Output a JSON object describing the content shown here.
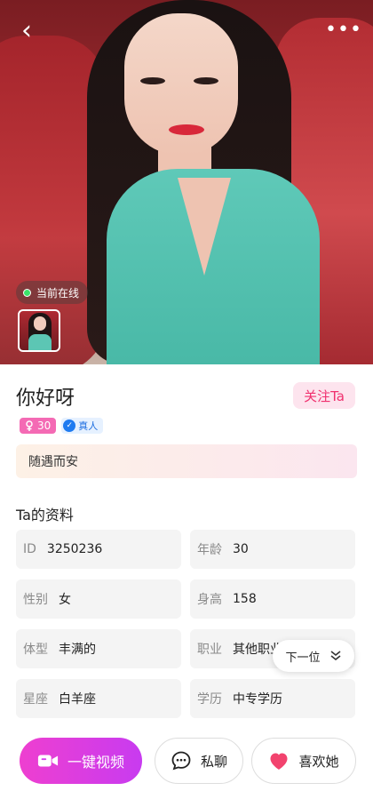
{
  "header": {
    "back_icon": "chevron-left-icon",
    "back_glyph": "‹",
    "more_icon": "more-horizontal-icon",
    "more_glyph": "•••"
  },
  "hero": {
    "online_status": "当前在线",
    "online_color": "#3be36a"
  },
  "profile": {
    "name": "你好呀",
    "follow_label": "关注Ta",
    "age_tag": "30",
    "verified_tag": "真人",
    "motto": "随遇而安"
  },
  "details": {
    "section_title": "Ta的资料",
    "fields": [
      {
        "label": "ID",
        "value": "3250236"
      },
      {
        "label": "年龄",
        "value": "30"
      },
      {
        "label": "性别",
        "value": "女"
      },
      {
        "label": "身高",
        "value": "158"
      },
      {
        "label": "体型",
        "value": "丰满的"
      },
      {
        "label": "职业",
        "value": "其他职业"
      },
      {
        "label": "星座",
        "value": "白羊座"
      },
      {
        "label": "学历",
        "value": "中专学历"
      }
    ]
  },
  "next_button": {
    "label": "下一位",
    "icon": "double-chevron-down-icon"
  },
  "actions": {
    "video_label": "一键视频",
    "chat_label": "私聊",
    "like_label": "喜欢她"
  },
  "colors": {
    "accent_pink": "#f0306e",
    "video_gradient_start": "#ee3fd0",
    "video_gradient_end": "#c83bf0",
    "heart": "#f2436e"
  }
}
